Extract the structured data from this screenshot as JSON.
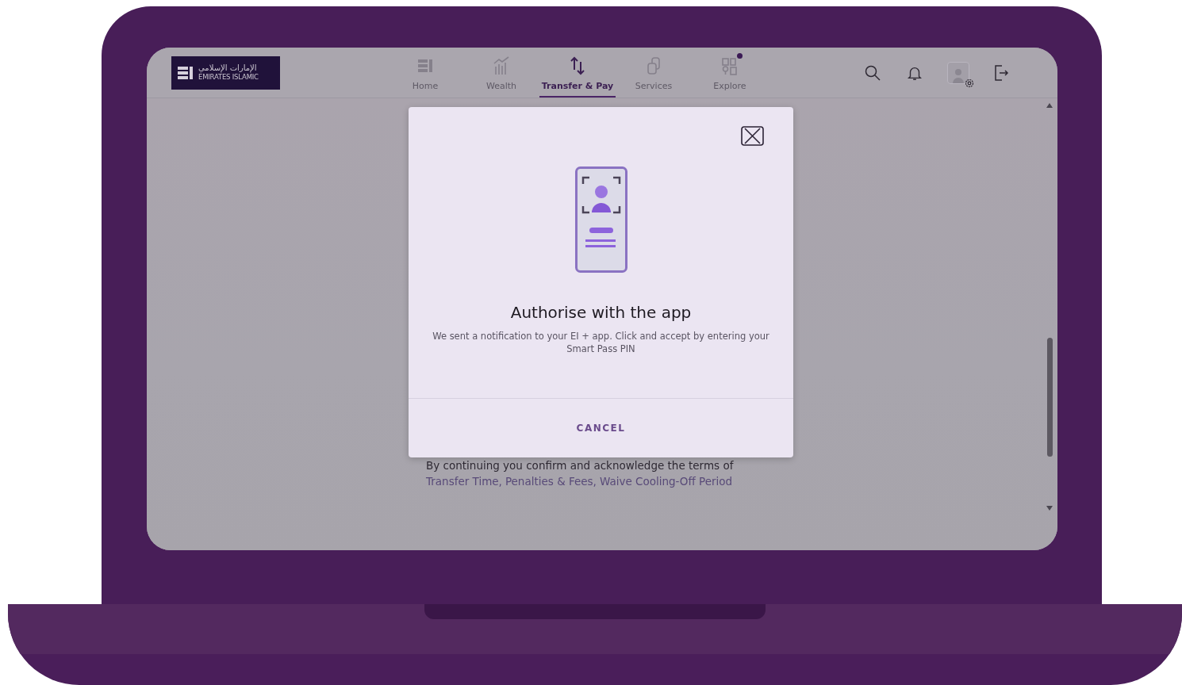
{
  "logo": {
    "arabic": "الإمارات الإسلامي",
    "english": "EMIRATES ISLAMIC"
  },
  "nav": [
    {
      "label": "Home",
      "kind": "home",
      "selected": false,
      "badge": false
    },
    {
      "label": "Wealth",
      "kind": "wealth",
      "selected": false,
      "badge": false
    },
    {
      "label": "Transfer & Pay",
      "kind": "transfer",
      "selected": true,
      "badge": false
    },
    {
      "label": "Services",
      "kind": "services",
      "selected": false,
      "badge": false
    },
    {
      "label": "Explore",
      "kind": "explore",
      "selected": false,
      "badge": true
    }
  ],
  "terms": {
    "intro": "By continuing you confirm and acknowledge the terms of",
    "links": [
      "Transfer Time,",
      "Penalties & Fees,",
      "Waive Cooling-Off Period"
    ]
  },
  "modal": {
    "title": "Authorise with the app",
    "message": "We sent a notification to your EI + app. Click and accept by entering your Smart Pass PIN",
    "cancel": "CANCEL"
  }
}
